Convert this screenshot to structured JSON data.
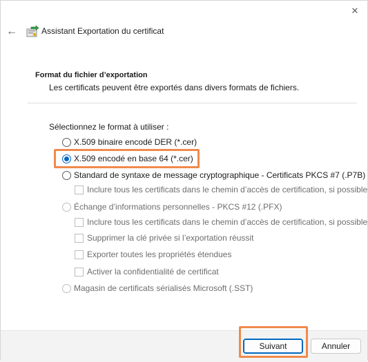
{
  "window": {
    "close_glyph": "✕"
  },
  "header": {
    "back_glyph": "←",
    "title": "Assistant Exportation du certificat",
    "icon": "certificate-wizard-icon"
  },
  "section": {
    "heading": "Format du fichier d’exportation",
    "description": "Les certificats peuvent être exportés dans divers formats de fichiers."
  },
  "prompt": "Sélectionnez le format à utiliser :",
  "options": {
    "der": {
      "label": "X.509 binaire encodé DER (*.cer)",
      "checked": false,
      "enabled": true
    },
    "base64": {
      "label": "X.509 encodé en base 64 (*.cer)",
      "checked": true,
      "enabled": true
    },
    "pkcs7": {
      "label": "Standard de syntaxe de message cryptographique - Certificats PKCS #7 (.P7B)",
      "checked": false,
      "enabled": true
    },
    "pkcs7_include_chain": {
      "label": "Inclure tous les certificats dans le chemin d’accès de certification, si possible",
      "checked": false,
      "enabled": false
    },
    "pfx": {
      "label": "Échange d’informations personnelles - PKCS #12 (.PFX)",
      "checked": false,
      "enabled": false
    },
    "pfx_include_chain": {
      "label": "Inclure tous les certificats dans le chemin d’accès de certification, si possible",
      "checked": false,
      "enabled": false
    },
    "pfx_delete_key": {
      "label": "Supprimer la clé privée si l’exportation réussit",
      "checked": false,
      "enabled": false
    },
    "pfx_export_props": {
      "label": "Exporter toutes les propriétés étendues",
      "checked": false,
      "enabled": false
    },
    "pfx_privacy": {
      "label": "Activer la confidentialité de certificat",
      "checked": false,
      "enabled": false
    },
    "sst": {
      "label": "Magasin de certificats sérialisés Microsoft (.SST)",
      "checked": false,
      "enabled": false
    }
  },
  "footer": {
    "next_label": "Suivant",
    "cancel_label": "Annuler"
  },
  "colors": {
    "accent": "#0067c0",
    "highlight": "#f08a4b"
  }
}
